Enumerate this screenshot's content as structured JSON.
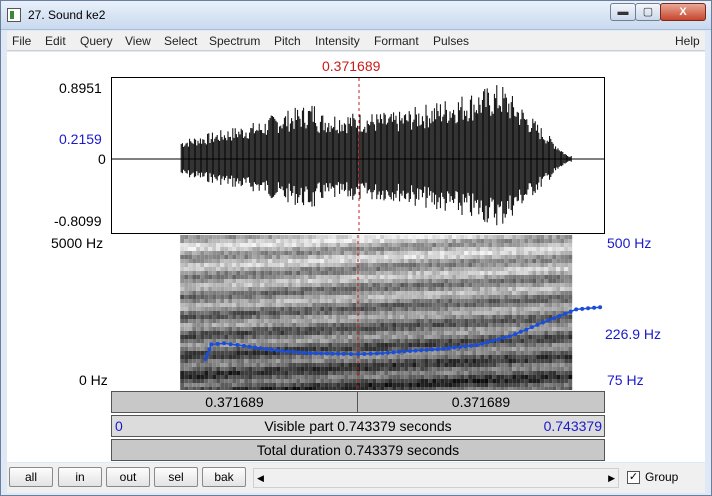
{
  "window": {
    "title": "27. Sound ke2",
    "controls": {
      "minimize": "▬",
      "maximize": "▢",
      "close": "X"
    }
  },
  "menu": [
    "File",
    "Edit",
    "Query",
    "View",
    "Select",
    "Spectrum",
    "Pitch",
    "Intensity",
    "Formant",
    "Pulses",
    "Help"
  ],
  "cursor_time": "0.371689",
  "waveform": {
    "y_max": "0.8951",
    "y_cursor_value": "0.2159",
    "y_zero": "0",
    "y_min": "-0.8099",
    "start_fraction": 0.14,
    "end_fraction": 0.93
  },
  "spectrogram": {
    "freq_top": "5000 Hz",
    "freq_bottom": "0 Hz",
    "pitch_top": "500 Hz",
    "pitch_mid": "226.9 Hz",
    "pitch_bottom": "75 Hz"
  },
  "pitch_track": {
    "unit": "Hz",
    "points": [
      [
        0.142,
        160
      ],
      [
        0.151,
        200
      ],
      [
        0.17,
        203
      ],
      [
        0.2,
        196
      ],
      [
        0.25,
        183
      ],
      [
        0.3,
        176
      ],
      [
        0.35,
        174
      ],
      [
        0.372,
        173
      ],
      [
        0.4,
        175
      ],
      [
        0.45,
        182
      ],
      [
        0.5,
        188
      ],
      [
        0.55,
        198
      ],
      [
        0.6,
        222
      ],
      [
        0.65,
        260
      ],
      [
        0.7,
        296
      ],
      [
        0.736,
        302
      ]
    ],
    "time_range": [
      0,
      0.743379
    ],
    "pitch_range": [
      75,
      500
    ]
  },
  "panels": {
    "left_time": "0.371689",
    "right_time": "0.371689",
    "visible_start": "0",
    "visible_label": "Visible part 0.743379 seconds",
    "visible_end": "0.743379",
    "total_label": "Total duration 0.743379 seconds"
  },
  "buttons": {
    "all": "all",
    "in": "in",
    "out": "out",
    "sel": "sel",
    "bak": "bak"
  },
  "scroll": {
    "left_arrow": "◀",
    "right_arrow": "▶"
  },
  "group": {
    "checked": "✓",
    "label": "Group"
  },
  "colors": {
    "cursor": "#cc1a1a",
    "axis_blue": "#1a1acc",
    "pitch": "#1a4ed8"
  }
}
